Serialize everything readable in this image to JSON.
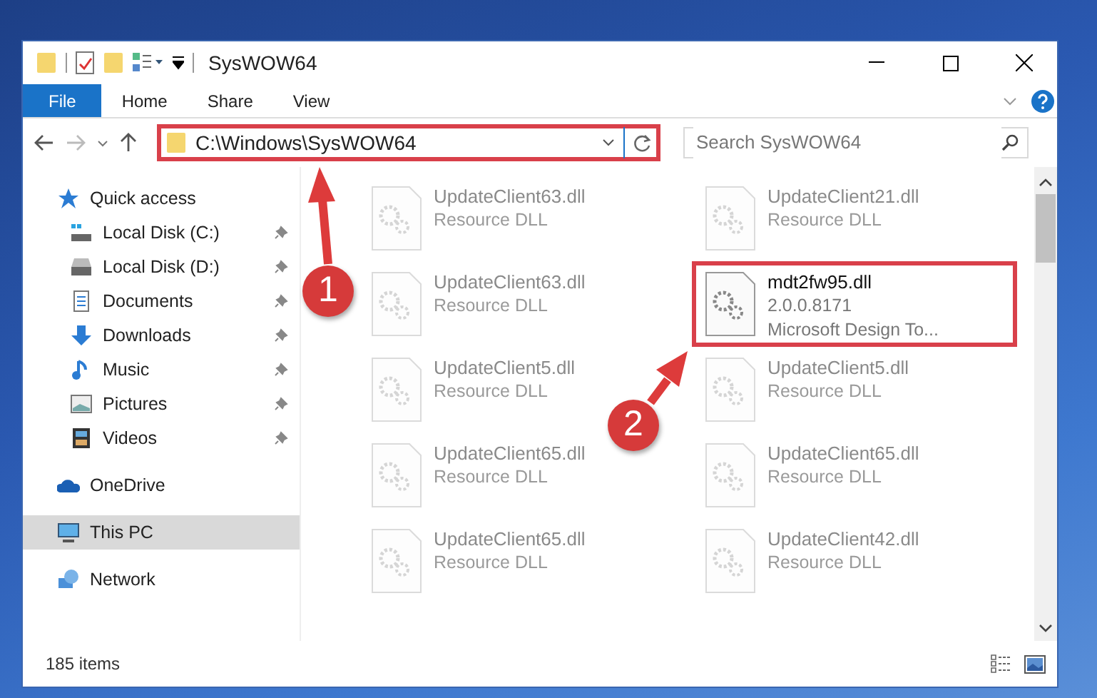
{
  "window": {
    "title": "SysWOW64"
  },
  "ribbon": {
    "tabs": [
      {
        "label": "File",
        "kind": "file"
      },
      {
        "label": "Home",
        "kind": "tab"
      },
      {
        "label": "Share",
        "kind": "tab"
      },
      {
        "label": "View",
        "kind": "tab"
      }
    ]
  },
  "address_bar": {
    "path": "C:\\Windows\\SysWOW64",
    "highlighted": true
  },
  "search": {
    "placeholder": "Search SysWOW64"
  },
  "sidebar": {
    "items": [
      {
        "label": "Quick access",
        "kind": "star",
        "selected": false,
        "children": [
          {
            "label": "Local Disk (C:)",
            "kind": "drive-c",
            "pinned": true,
            "selected": false
          },
          {
            "label": "Local Disk (D:)",
            "kind": "drive",
            "pinned": true,
            "selected": false
          },
          {
            "label": "Documents",
            "kind": "documents",
            "pinned": true,
            "selected": false
          },
          {
            "label": "Downloads",
            "kind": "downloads",
            "pinned": true,
            "selected": false
          },
          {
            "label": "Music",
            "kind": "music",
            "pinned": true,
            "selected": false
          },
          {
            "label": "Pictures",
            "kind": "pictures",
            "pinned": true,
            "selected": false
          },
          {
            "label": "Videos",
            "kind": "videos",
            "pinned": true,
            "selected": false
          }
        ]
      },
      {
        "label": "OneDrive",
        "kind": "cloud",
        "selected": false
      },
      {
        "label": "This PC",
        "kind": "pc",
        "selected": true
      },
      {
        "label": "Network",
        "kind": "network",
        "selected": false
      }
    ]
  },
  "files": [
    {
      "name": "UpdateClient63.dll",
      "lines": [
        "Resource DLL"
      ],
      "faded": true,
      "highlighted": false
    },
    {
      "name": "UpdateClient21.dll",
      "lines": [
        "Resource DLL"
      ],
      "faded": true,
      "highlighted": false
    },
    {
      "name": "UpdateClient63.dll",
      "lines": [
        "Resource DLL"
      ],
      "faded": true,
      "highlighted": false
    },
    {
      "name": "mdt2fw95.dll",
      "lines": [
        "2.0.0.8171",
        "Microsoft Design To..."
      ],
      "faded": false,
      "highlighted": true
    },
    {
      "name": "UpdateClient5.dll",
      "lines": [
        "Resource DLL"
      ],
      "faded": true,
      "highlighted": false
    },
    {
      "name": "UpdateClient5.dll",
      "lines": [
        "Resource DLL"
      ],
      "faded": true,
      "highlighted": false
    },
    {
      "name": "UpdateClient65.dll",
      "lines": [
        "Resource DLL"
      ],
      "faded": true,
      "highlighted": false
    },
    {
      "name": "UpdateClient65.dll",
      "lines": [
        "Resource DLL"
      ],
      "faded": true,
      "highlighted": false
    },
    {
      "name": "UpdateClient65.dll",
      "lines": [
        "Resource DLL"
      ],
      "faded": true,
      "highlighted": false
    },
    {
      "name": "UpdateClient42.dll",
      "lines": [
        "Resource DLL"
      ],
      "faded": true,
      "highlighted": false
    }
  ],
  "annotations": [
    {
      "label": "1"
    },
    {
      "label": "2"
    }
  ],
  "status_bar": {
    "item_count": "185 items"
  }
}
